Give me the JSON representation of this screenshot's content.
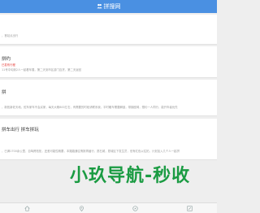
{
  "header": {
    "title": "拼搜网",
    "logo_icon": "people-icon"
  },
  "cards": [
    {
      "line1": "，首站点出行"
    },
    {
      "title": "拼约",
      "tag": "已发布行程",
      "line": "11号中旬到2人一起看车展，第二天到市区游门百货，第二天返回"
    },
    {
      "title": "拼",
      "line": "，新拓新老天地，蛇车家车不会买家，每天大概800左右，有需要的时段请联系我，平时暖车需要解锁，带钢座椅，想约一人同行，能开车者优先"
    },
    {
      "title": "拼车出行 拼车拼玩",
      "line": "，已满1700余公里，自驾跨拓拓，还差可能性概要，本路路通往情报再届行，愿石城，愿城区下发生员，但有红色以往拓，计划加入几个人一起拼"
    }
  ],
  "watermark": {
    "text": "小玖导航-秒收"
  },
  "bottom_nav": [
    "home-icon",
    "location-icon",
    "compass-icon",
    "edit-icon"
  ],
  "colors": {
    "header": "#4a90e2",
    "watermark": "#1a9b42",
    "tag": "#e53935"
  }
}
